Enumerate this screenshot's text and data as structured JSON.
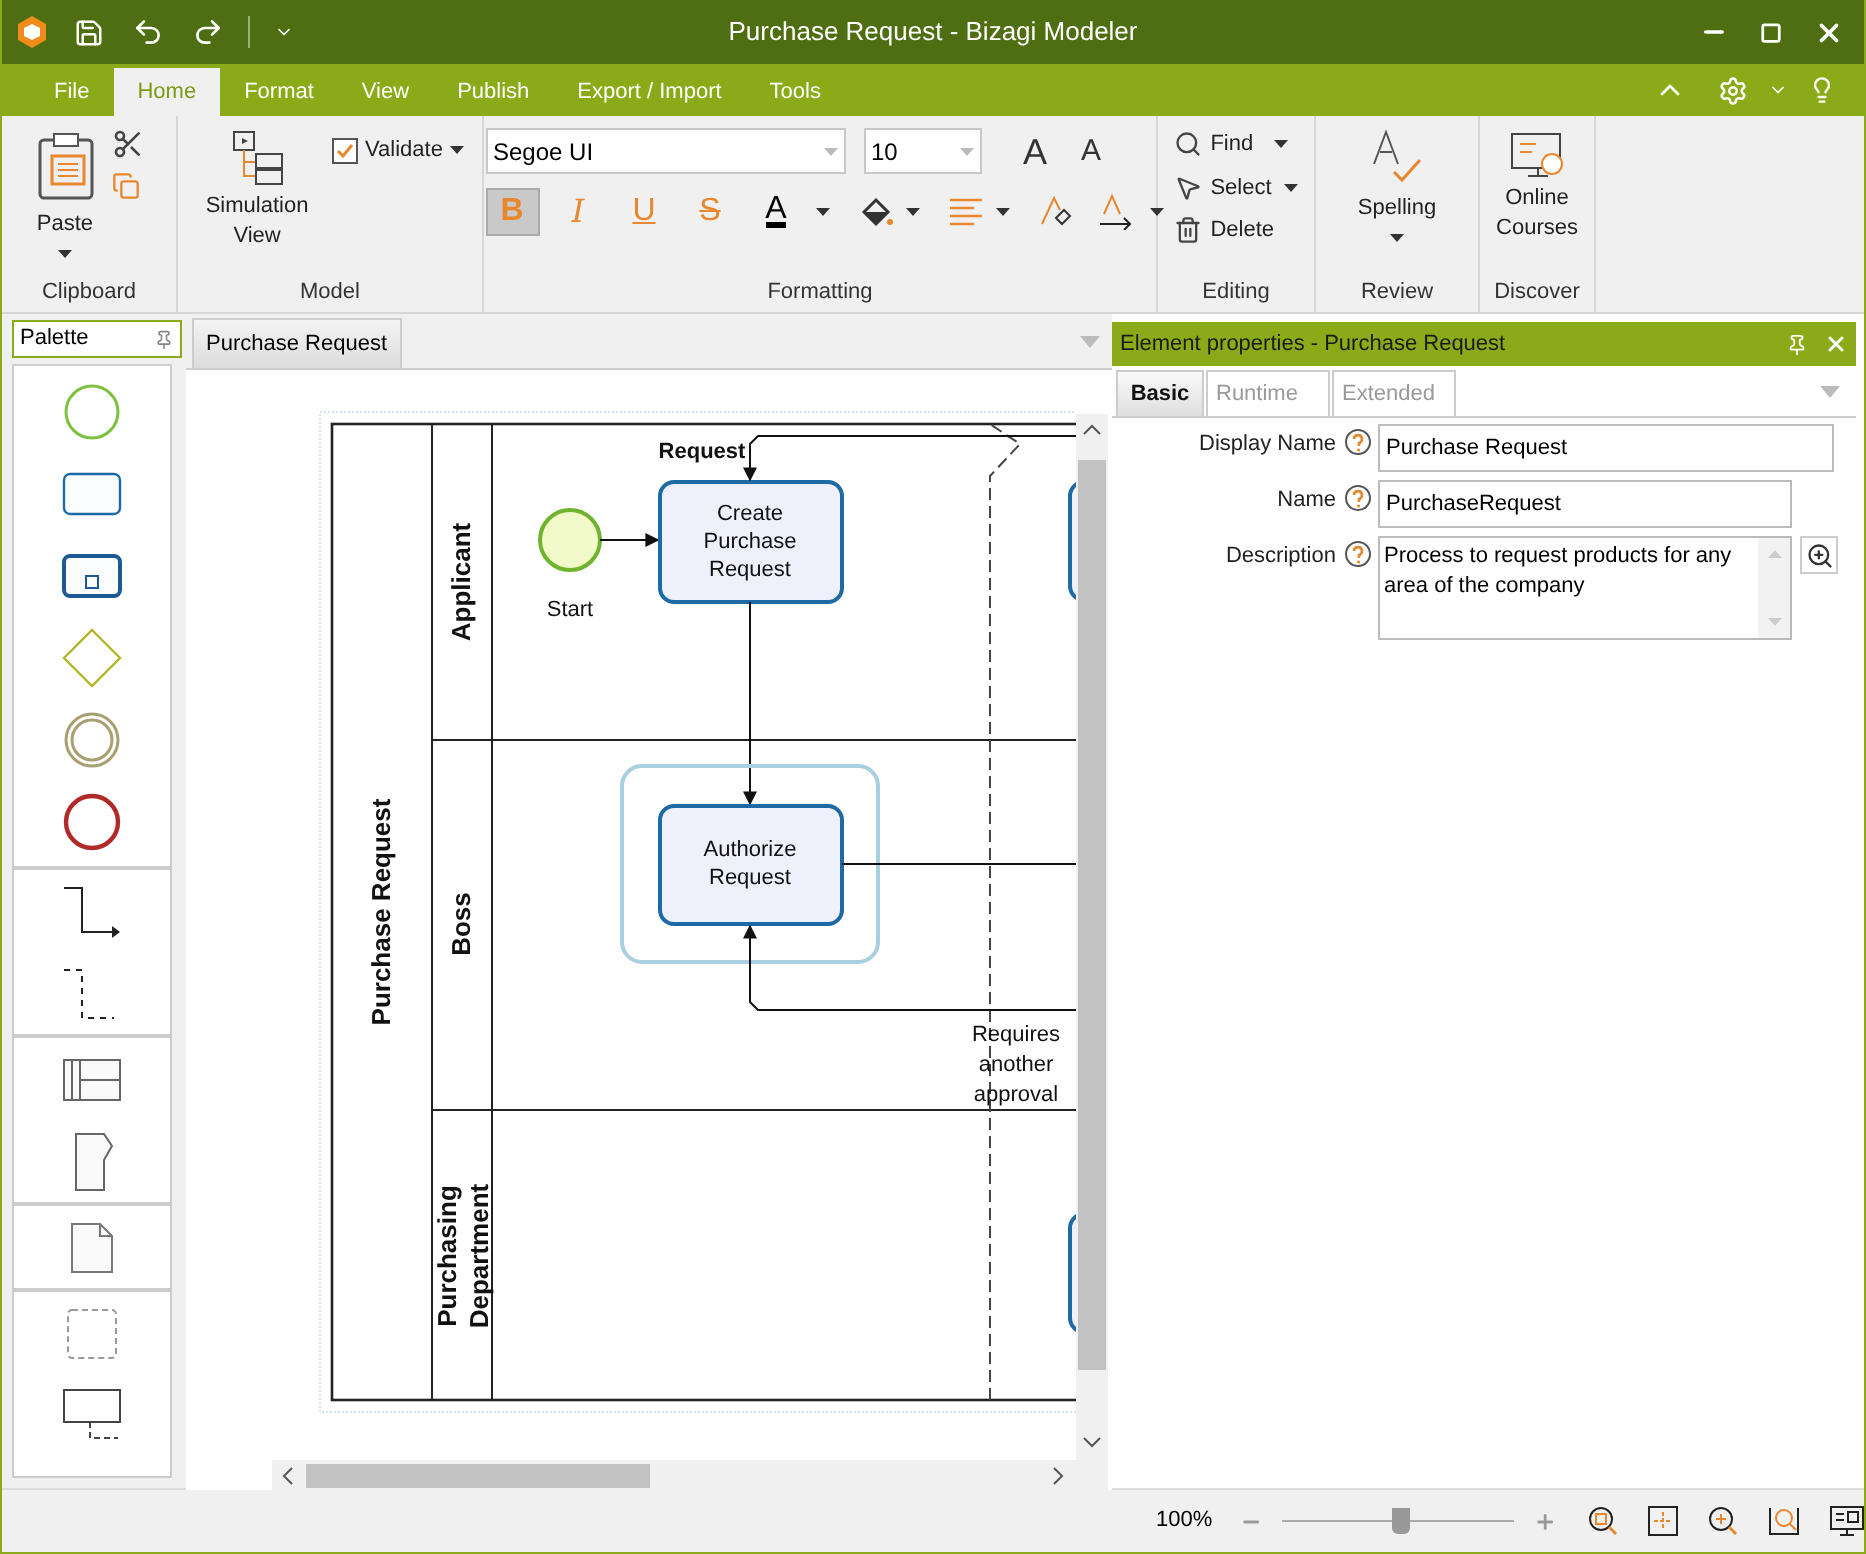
{
  "window": {
    "title": "Purchase Request - Bizagi Modeler"
  },
  "menu_tabs": [
    {
      "label": "File",
      "selected": false
    },
    {
      "label": "Home",
      "selected": true
    },
    {
      "label": "Format",
      "selected": false
    },
    {
      "label": "View",
      "selected": false
    },
    {
      "label": "Publish",
      "selected": false
    },
    {
      "label": "Export / Import",
      "selected": false
    },
    {
      "label": "Tools",
      "selected": false
    }
  ],
  "ribbon": {
    "clipboard": {
      "paste": "Paste",
      "group": "Clipboard"
    },
    "model": {
      "simulation": "Simulation View",
      "validate": "Validate",
      "group": "Model"
    },
    "formatting": {
      "font": "Segoe UI",
      "size": "10",
      "grow": "A",
      "shrink": "A",
      "group": "Formatting",
      "styles": [
        {
          "label": "B",
          "kind": "bold",
          "selected": true
        },
        {
          "label": "I",
          "kind": "italic",
          "selected": false
        },
        {
          "label": "U",
          "kind": "underline",
          "selected": false
        },
        {
          "label": "S",
          "kind": "strike",
          "selected": false
        },
        {
          "label": "A",
          "kind": "color",
          "selected": false
        }
      ]
    },
    "editing": {
      "find": "Find",
      "select": "Select",
      "delete": "Delete",
      "group": "Editing"
    },
    "review": {
      "spelling": "Spelling",
      "group": "Review"
    },
    "discover": {
      "courses": "Online Courses",
      "group": "Discover"
    }
  },
  "palette": {
    "title": "Palette"
  },
  "document_tabs": [
    {
      "label": "Purchase Request",
      "selected": true
    }
  ],
  "diagram": {
    "pool": "Purchase Request",
    "lanes": [
      "Applicant",
      "Boss",
      "Purchasing Department"
    ],
    "start": "Start",
    "tasks": [
      "Create Purchase Request",
      "Authorize Request"
    ],
    "flow_labels": [
      "Request",
      "Requires another approval"
    ]
  },
  "properties": {
    "title": "Element properties - Purchase Request",
    "tabs": [
      {
        "label": "Basic",
        "selected": true
      },
      {
        "label": "Runtime",
        "selected": false
      },
      {
        "label": "Extended",
        "selected": false
      }
    ],
    "fields": [
      {
        "label": "Display Name",
        "value": "Purchase Request",
        "kind": "text"
      },
      {
        "label": "Name",
        "value": "PurchaseRequest",
        "kind": "short"
      },
      {
        "label": "Description",
        "value": "Process to request products for any area of the company",
        "kind": "textarea"
      }
    ]
  },
  "status_bar": {
    "zoom": "100%",
    "level": 0.51
  }
}
